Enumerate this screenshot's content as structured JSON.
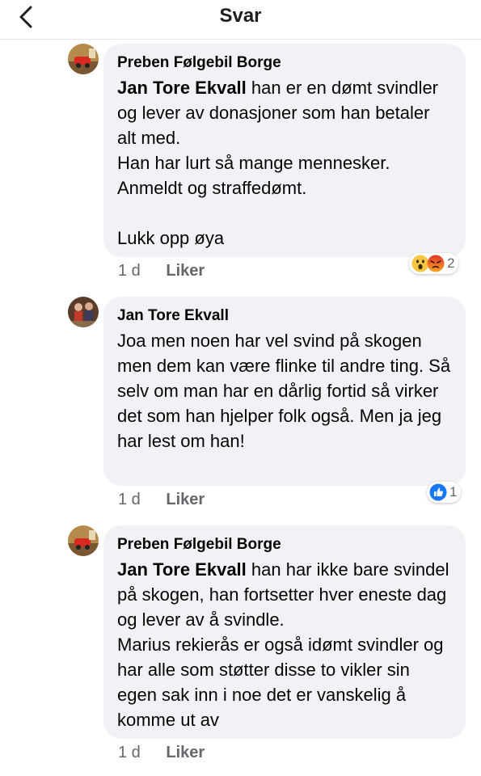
{
  "header": {
    "title": "Svar"
  },
  "comments": [
    {
      "author": "Preben Følgebil Borge",
      "mention": "Jan Tore Ekvall",
      "text": " han er en dømt svindler og lever av donasjoner som han betaler alt med.\nHan har lurt så mange mennesker.\nAnmeldt og straffedømt.\n\nLukk opp øya",
      "time": "1 d",
      "like_label": "Liker",
      "reactions": [
        "wow",
        "angry"
      ],
      "reaction_count": "2"
    },
    {
      "author": "Jan Tore Ekvall",
      "mention": "",
      "text": "Joa men noen har vel svind på skogen men dem kan være flinke til andre ting. Så selv om man har en dårlig fortid så virker det som han hjelper folk også. Men ja jeg har lest om han!",
      "time": "1 d",
      "like_label": "Liker",
      "reactions": [
        "like"
      ],
      "reaction_count": "1"
    },
    {
      "author": "Preben Følgebil Borge",
      "mention": "Jan Tore Ekvall",
      "text": " han har ikke bare svindel på skogen, han fortsetter hver eneste dag og lever av å svindle.\nMarius rekierås er også idømt svindler og har alle som støtter disse to vikler sin egen sak inn i noe det er vanskelig å komme ut av",
      "time": "1 d",
      "like_label": "Liker"
    }
  ],
  "colors": {
    "bubble": "#f0f2f5",
    "meta_text": "#65676b",
    "like_blue": "#1877f2",
    "wow_yellow": "#f7c544",
    "angry_orange": "#e9710f"
  }
}
